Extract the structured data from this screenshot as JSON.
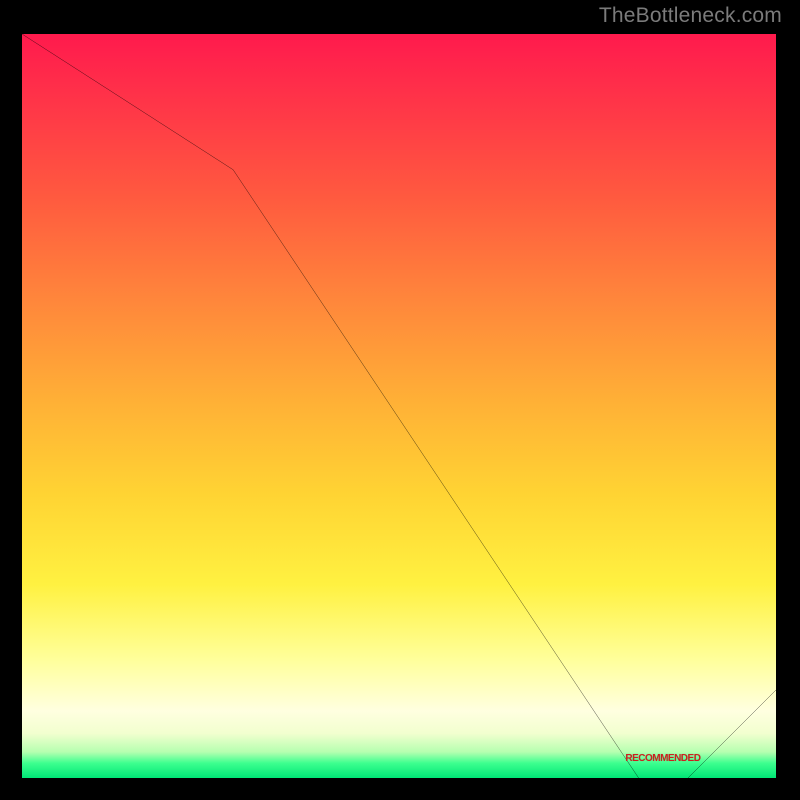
{
  "watermark": "TheBottleneck.com",
  "marker_label": "RECOMMENDED",
  "chart_data": {
    "type": "line",
    "title": "",
    "xlabel": "",
    "ylabel": "",
    "xlim": [
      0,
      100
    ],
    "ylim": [
      0,
      100
    ],
    "x": [
      0,
      28,
      82,
      88,
      100
    ],
    "values": [
      100,
      82,
      1,
      1,
      13
    ],
    "marker_x": 85,
    "marker_y": 2,
    "annotations": [
      "RECOMMENDED"
    ]
  },
  "colors": {
    "frame": "#000000",
    "line": "#000000",
    "marker_text": "#cc1f1f",
    "watermark": "#7b7b7b"
  }
}
